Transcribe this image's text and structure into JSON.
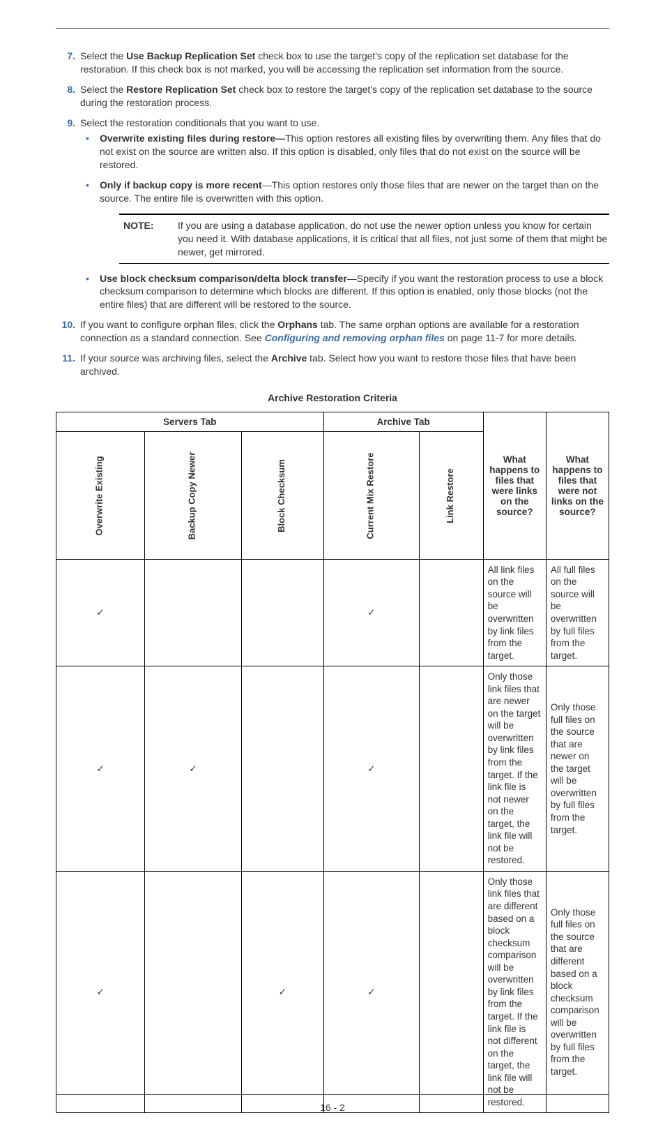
{
  "steps": {
    "s7_a": "Select the ",
    "s7_b": "Use Backup Replication Set",
    "s7_c": " check box to use the target's copy of the replication set database for the restoration. If this check box is not marked, you will be accessing the replication set information from the source.",
    "s8_a": "Select the ",
    "s8_b": "Restore Replication Set",
    "s8_c": " check box to restore the target's copy of the replication set database to the source during the restoration process.",
    "s9": "Select the restoration conditionals that you want to use.",
    "b1_t": "Overwrite existing files during restore—",
    "b1_r": "This option restores all existing files by overwriting them. Any files that do not exist on the source are written also. If this option is disabled, only files that do not exist on the source will be restored.",
    "b2_t": "Only if backup copy is more recent",
    "b2_r": "—This option restores only those files that are newer on the target than on the source. The entire file is overwritten with this option.",
    "note_label": "NOTE:",
    "note_text": "If you are using a database application, do not use the newer option unless you know for certain you need it. With database applications, it is critical that all files, not just some of them that might be newer, get mirrored.",
    "b3_t": "Use block checksum comparison/delta block transfer",
    "b3_r": "—Specify if you want the restoration process to use a block checksum comparison to determine which blocks are different. If this option is enabled, only those blocks (not the entire files) that are different will be restored to the source.",
    "s10_a": "If you want to configure orphan files, click the ",
    "s10_b": "Orphans",
    "s10_c": " tab. The same orphan options are available for a restoration connection as a standard connection. See ",
    "s10_link": "Configuring and removing orphan files",
    "s10_d": " on page 11-7 for more details.",
    "s11_a": "If your source was archiving files, select the ",
    "s11_b": "Archive",
    "s11_c": " tab. Select how you want to restore those files that have been archived."
  },
  "table_title": "Archive Restoration Criteria",
  "headers": {
    "servers_tab": "Servers Tab",
    "archive_tab": "Archive Tab",
    "col1": "Overwrite Existing",
    "col2": "Backup Copy Newer",
    "col3": "Block Checksum",
    "col4": "Current Mix Restore",
    "col5": "Link Restore",
    "q_links": "What happens to files that were links on the source?",
    "q_notlinks": "What happens to files that were not links on the source?"
  },
  "rows": [
    {
      "c1": "✓",
      "c2": "",
      "c3": "",
      "c4": "✓",
      "c5": "",
      "links": "All link files on the source will be overwritten by link files from the target.",
      "notlinks": "All full files on the source will be overwritten by full files from the target."
    },
    {
      "c1": "✓",
      "c2": "✓",
      "c3": "",
      "c4": "✓",
      "c5": "",
      "links": "Only those link files that are newer on the target will be overwritten by link files from the target. If the link file is not newer on the target, the link file will not be restored.",
      "notlinks": "Only those full files on the source that are newer on the target will be overwritten by full files from the target."
    },
    {
      "c1": "✓",
      "c2": "",
      "c3": "✓",
      "c4": "✓",
      "c5": "",
      "links": "Only those link files that are different based on a block checksum comparison will be overwritten by link files from the target. If the link file is not different on the target, the link file will not be restored.",
      "notlinks": "Only those full files on the source that are different based on a block checksum comparison will be overwritten by full files from the target."
    }
  ],
  "page_number": "16 - 2"
}
